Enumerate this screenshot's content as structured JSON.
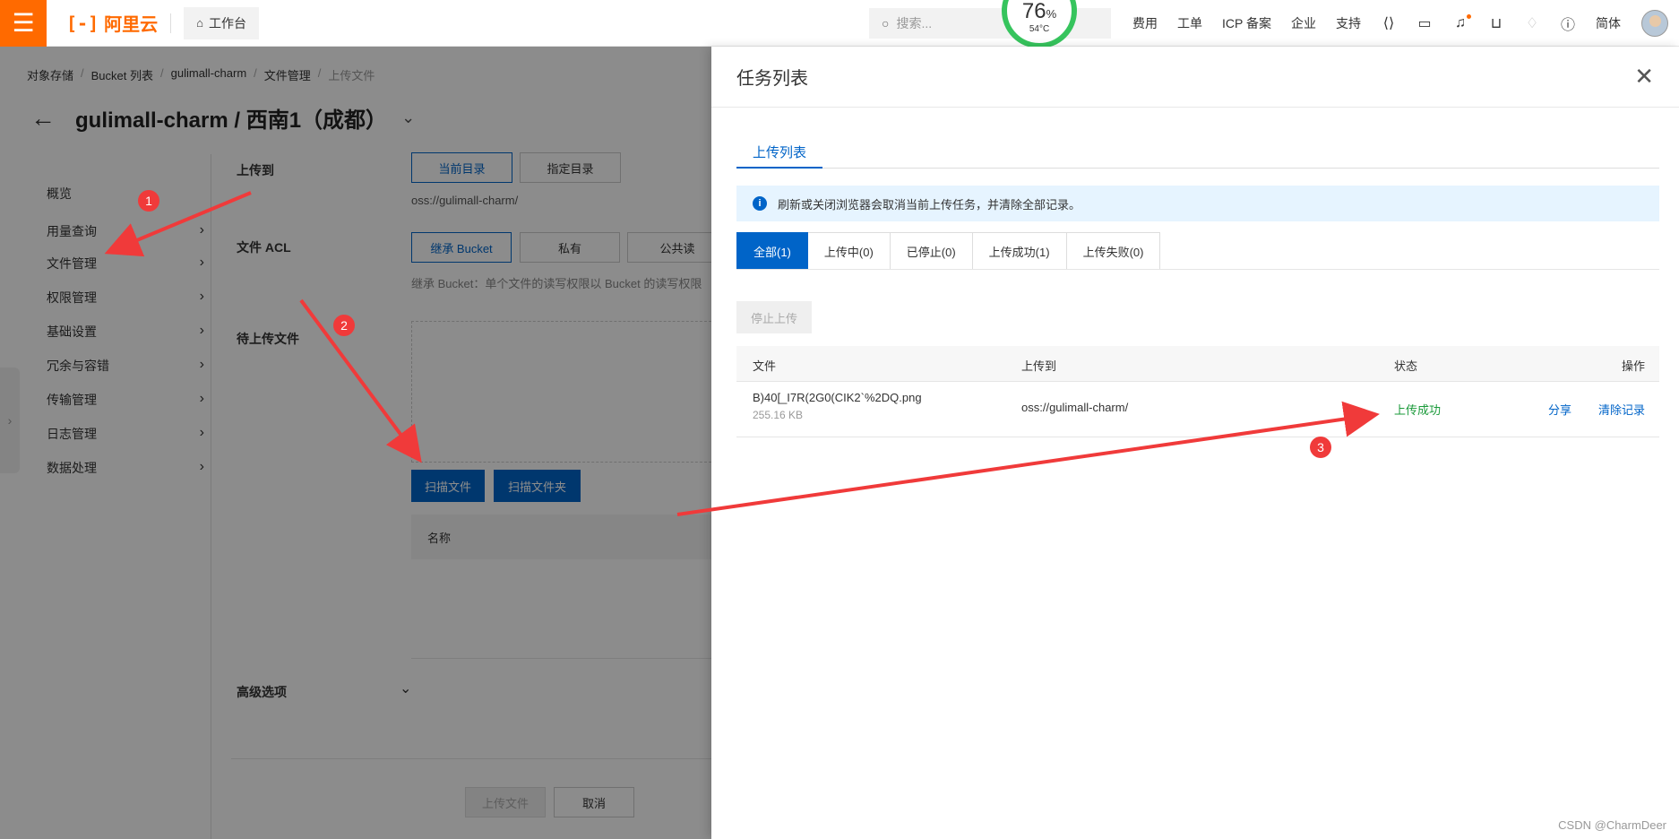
{
  "topbar": {
    "brand": "阿里云",
    "brand_mark": "[-]",
    "workbench": "工作台",
    "search_placeholder": "搜索...",
    "gauge_value": "76",
    "gauge_unit": "%",
    "gauge_temp": "54°C",
    "links": [
      "费用",
      "工单",
      "ICP 备案",
      "企业",
      "支持"
    ],
    "lang": "简体"
  },
  "breadcrumb": [
    "对象存储",
    "Bucket 列表",
    "gulimall-charm",
    "文件管理",
    "上传文件"
  ],
  "page_title": "gulimall-charm / 西南1（成都）",
  "sidenav": [
    "概览",
    "用量查询",
    "文件管理",
    "权限管理",
    "基础设置",
    "冗余与容错",
    "传输管理",
    "日志管理",
    "数据处理"
  ],
  "form": {
    "upload_to_label": "上传到",
    "upload_to_options": [
      "当前目录",
      "指定目录"
    ],
    "upload_path": "oss://gulimall-charm/",
    "acl_label": "文件 ACL",
    "acl_options": [
      "继承 Bucket",
      "私有",
      "公共读"
    ],
    "acl_hint": "继承 Bucket：单个文件的读写权限以 Bucket 的读写权限",
    "pending_label": "待上传文件",
    "scan_file": "扫描文件",
    "scan_folder": "扫描文件夹",
    "name_col": "名称",
    "advanced": "高级选项",
    "upload_btn": "上传文件",
    "cancel_btn": "取消"
  },
  "drawer": {
    "title": "任务列表",
    "tab": "上传列表",
    "notice": "刷新或关闭浏览器会取消当前上传任务，并清除全部记录。",
    "filters": [
      "全部(1)",
      "上传中(0)",
      "已停止(0)",
      "上传成功(1)",
      "上传失败(0)"
    ],
    "stop_btn": "停止上传",
    "columns": {
      "file": "文件",
      "dest": "上传到",
      "status": "状态",
      "action": "操作"
    },
    "rows": [
      {
        "file": "B)40[_I7R(2G0(CIK2`%2DQ.png",
        "size": "255.16 KB",
        "dest": "oss://gulimall-charm/",
        "status": "上传成功",
        "share": "分享",
        "clear": "清除记录"
      }
    ]
  },
  "annotations": [
    "1",
    "2",
    "3"
  ],
  "watermark": "CSDN @CharmDeer"
}
